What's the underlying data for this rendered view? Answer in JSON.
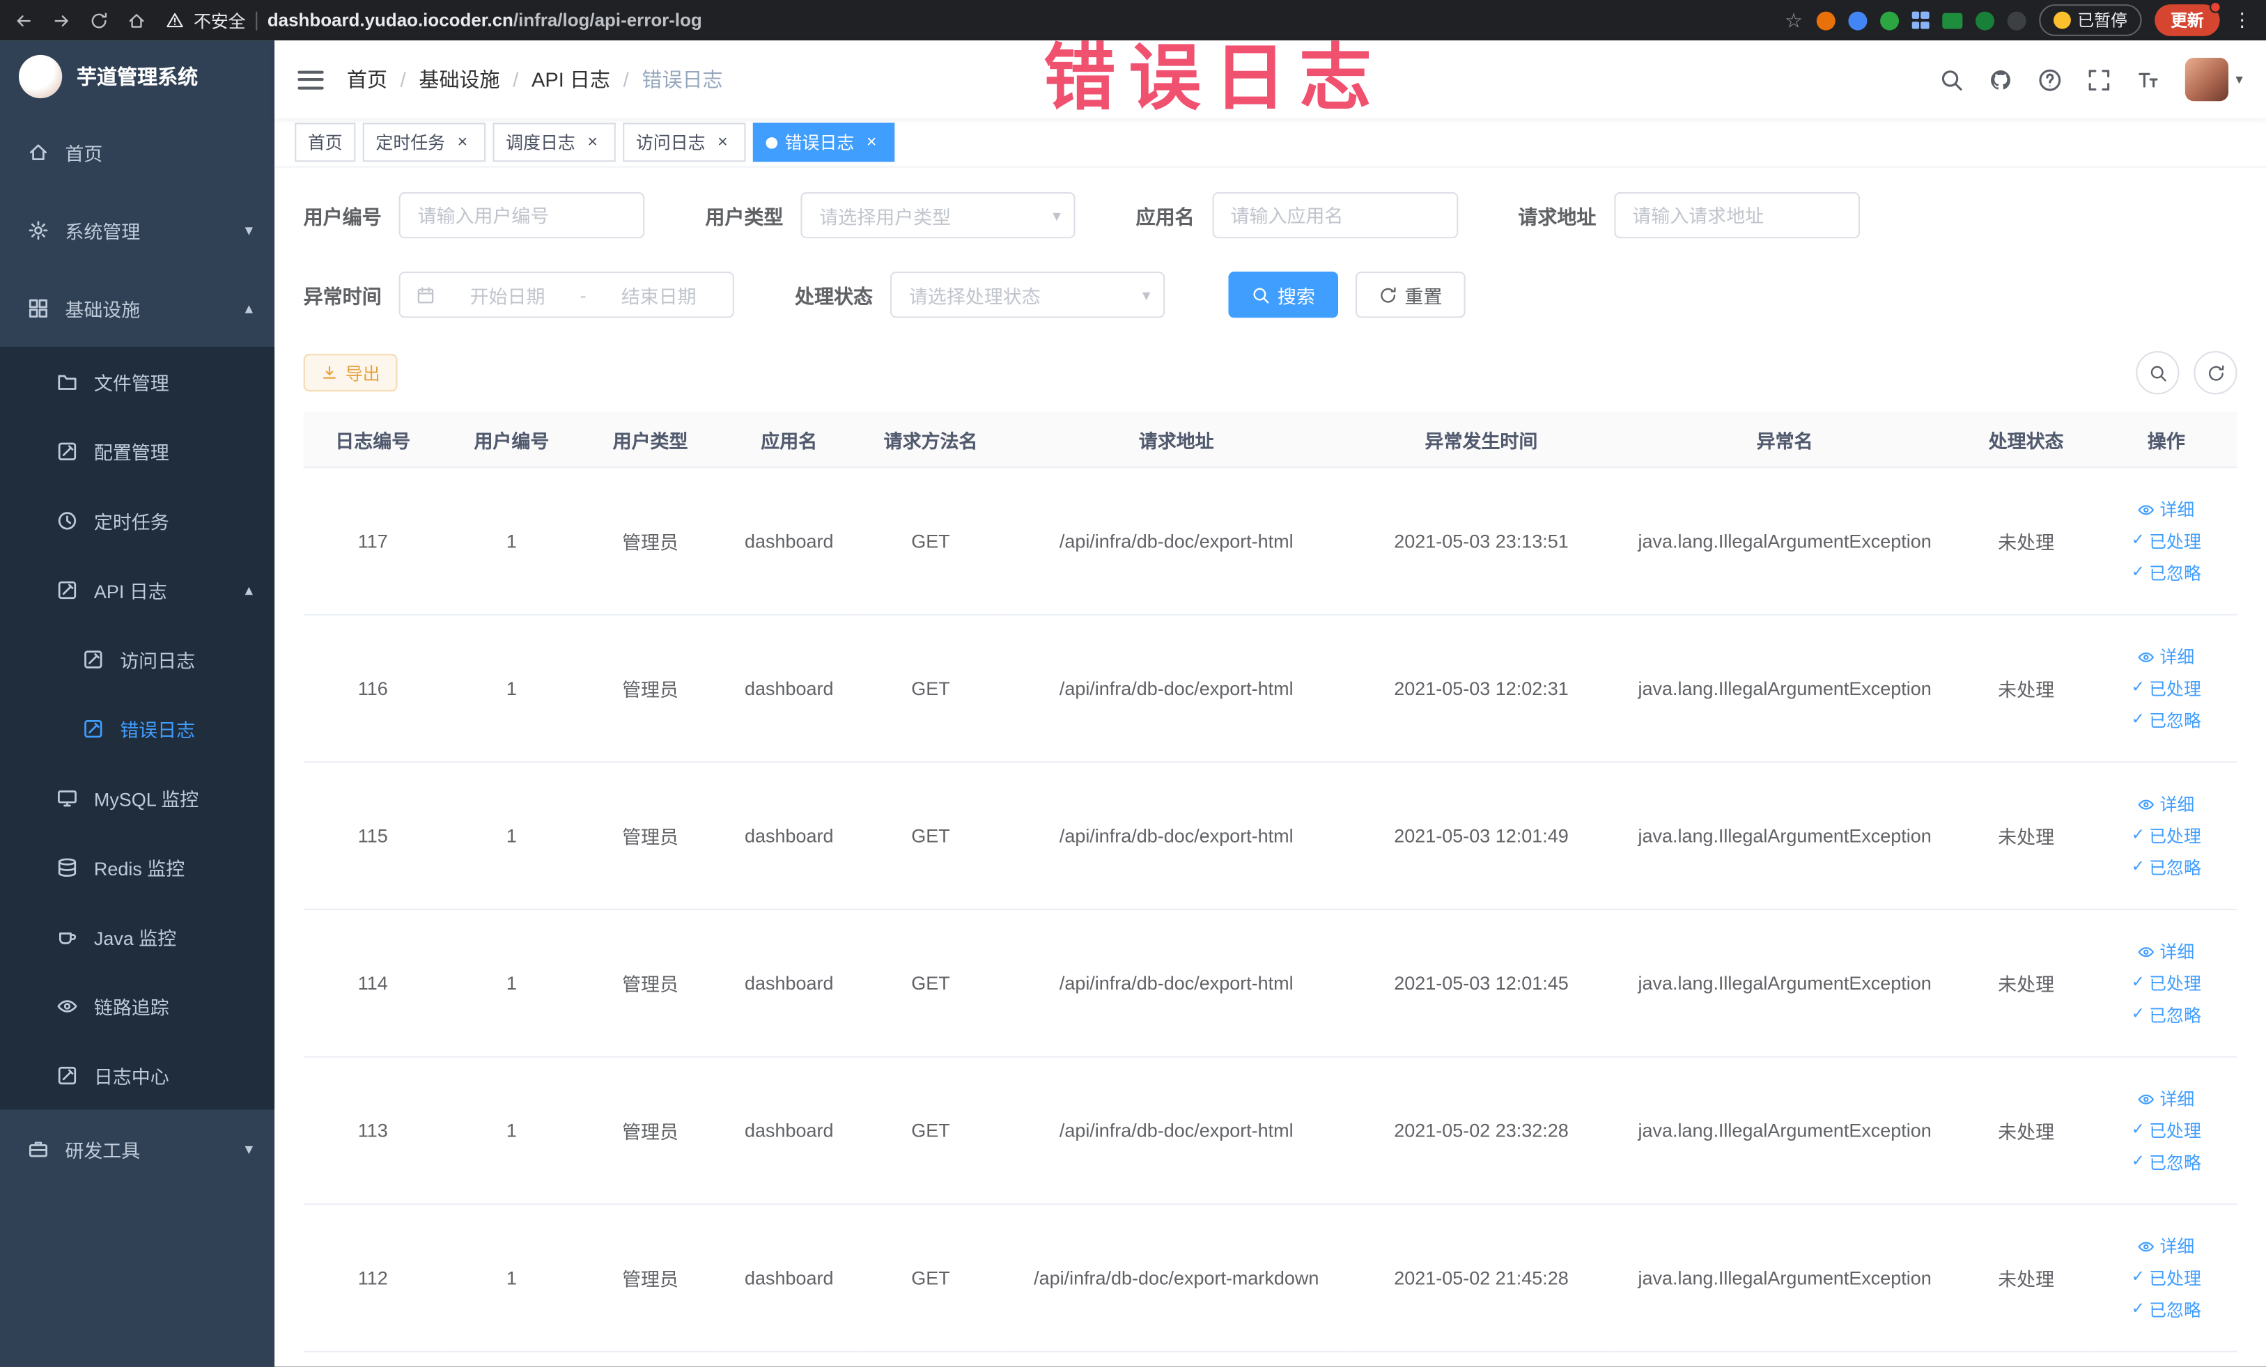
{
  "watermark": "错误日志",
  "colors": {
    "accent": "#409eff",
    "warning": "#e6a23c",
    "watermark": "#f0516f",
    "sidebar_bg": "#304156",
    "submenu_bg": "#1f2d3d"
  },
  "browser": {
    "security": "不安全",
    "url_domain": "dashboard.yudao.iocoder.cn",
    "url_path": "/infra/log/api-error-log",
    "paused": "已暂停",
    "update": "更新"
  },
  "sidebar": {
    "title": "芋道管理系统",
    "items": [
      {
        "id": "home",
        "label": "首页",
        "icon": "home",
        "level": 1
      },
      {
        "id": "system",
        "label": "系统管理",
        "icon": "gear",
        "level": 1,
        "arrow": "down"
      },
      {
        "id": "infra",
        "label": "基础设施",
        "icon": "grid",
        "level": 1,
        "arrow": "up"
      },
      {
        "id": "file",
        "label": "文件管理",
        "icon": "folder",
        "level": 2
      },
      {
        "id": "config",
        "label": "配置管理",
        "icon": "edit-square",
        "level": 2
      },
      {
        "id": "job",
        "label": "定时任务",
        "icon": "clock",
        "level": 2
      },
      {
        "id": "api-log",
        "label": "API 日志",
        "icon": "edit-square",
        "level": 2,
        "arrow": "up"
      },
      {
        "id": "access-log",
        "label": "访问日志",
        "icon": "edit-square",
        "level": 3
      },
      {
        "id": "error-log",
        "label": "错误日志",
        "icon": "edit-square",
        "level": 3,
        "active": true
      },
      {
        "id": "mysql",
        "label": "MySQL 监控",
        "icon": "monitor",
        "level": 2
      },
      {
        "id": "redis",
        "label": "Redis 监控",
        "icon": "database",
        "level": 2
      },
      {
        "id": "java",
        "label": "Java 监控",
        "icon": "coffee",
        "level": 2
      },
      {
        "id": "trace",
        "label": "链路追踪",
        "icon": "eye",
        "level": 2
      },
      {
        "id": "log-center",
        "label": "日志中心",
        "icon": "edit-square",
        "level": 2
      },
      {
        "id": "devtools",
        "label": "研发工具",
        "icon": "toolbox",
        "level": 1,
        "arrow": "down"
      }
    ]
  },
  "header": {
    "separator": "/",
    "breadcrumb": [
      "首页",
      "基础设施",
      "API 日志",
      "错误日志"
    ]
  },
  "tabs": [
    {
      "label": "首页",
      "closable": false,
      "active": false
    },
    {
      "label": "定时任务",
      "closable": true,
      "active": false
    },
    {
      "label": "调度日志",
      "closable": true,
      "active": false
    },
    {
      "label": "访问日志",
      "closable": true,
      "active": false
    },
    {
      "label": "错误日志",
      "closable": true,
      "active": true
    }
  ],
  "filters": {
    "user_id_label": "用户编号",
    "user_id_placeholder": "请输入用户编号",
    "user_type_label": "用户类型",
    "user_type_placeholder": "请选择用户类型",
    "app_name_label": "应用名",
    "app_name_placeholder": "请输入应用名",
    "request_url_label": "请求地址",
    "request_url_placeholder": "请输入请求地址",
    "time_label": "异常时间",
    "time_start_placeholder": "开始日期",
    "time_separator": "-",
    "time_end_placeholder": "结束日期",
    "status_label": "处理状态",
    "status_placeholder": "请选择处理状态",
    "search_button": "搜索",
    "reset_button": "重置"
  },
  "toolbar": {
    "export_button": "导出"
  },
  "table": {
    "columns": [
      "日志编号",
      "用户编号",
      "用户类型",
      "应用名",
      "请求方法名",
      "请求地址",
      "异常发生时间",
      "异常名",
      "处理状态",
      "操作"
    ],
    "actions": [
      {
        "id": "detail",
        "label": "详细",
        "icon": "eye"
      },
      {
        "id": "processed",
        "label": "已处理",
        "icon": "check"
      },
      {
        "id": "ignored",
        "label": "已忽略",
        "icon": "check"
      }
    ],
    "rows": [
      {
        "log_id": "117",
        "user_id": "1",
        "user_type": "管理员",
        "app_name": "dashboard",
        "method": "GET",
        "request_url": "/api/infra/db-doc/export-html",
        "time": "2021-05-03 23:13:51",
        "exception": "java.lang.IllegalArgumentException",
        "status": "未处理"
      },
      {
        "log_id": "116",
        "user_id": "1",
        "user_type": "管理员",
        "app_name": "dashboard",
        "method": "GET",
        "request_url": "/api/infra/db-doc/export-html",
        "time": "2021-05-03 12:02:31",
        "exception": "java.lang.IllegalArgumentException",
        "status": "未处理"
      },
      {
        "log_id": "115",
        "user_id": "1",
        "user_type": "管理员",
        "app_name": "dashboard",
        "method": "GET",
        "request_url": "/api/infra/db-doc/export-html",
        "time": "2021-05-03 12:01:49",
        "exception": "java.lang.IllegalArgumentException",
        "status": "未处理"
      },
      {
        "log_id": "114",
        "user_id": "1",
        "user_type": "管理员",
        "app_name": "dashboard",
        "method": "GET",
        "request_url": "/api/infra/db-doc/export-html",
        "time": "2021-05-03 12:01:45",
        "exception": "java.lang.IllegalArgumentException",
        "status": "未处理"
      },
      {
        "log_id": "113",
        "user_id": "1",
        "user_type": "管理员",
        "app_name": "dashboard",
        "method": "GET",
        "request_url": "/api/infra/db-doc/export-html",
        "time": "2021-05-02 23:32:28",
        "exception": "java.lang.IllegalArgumentException",
        "status": "未处理"
      },
      {
        "log_id": "112",
        "user_id": "1",
        "user_type": "管理员",
        "app_name": "dashboard",
        "method": "GET",
        "request_url": "/api/infra/db-doc/export-markdown",
        "time": "2021-05-02 21:45:28",
        "exception": "java.lang.IllegalArgumentException",
        "status": "未处理"
      }
    ]
  }
}
